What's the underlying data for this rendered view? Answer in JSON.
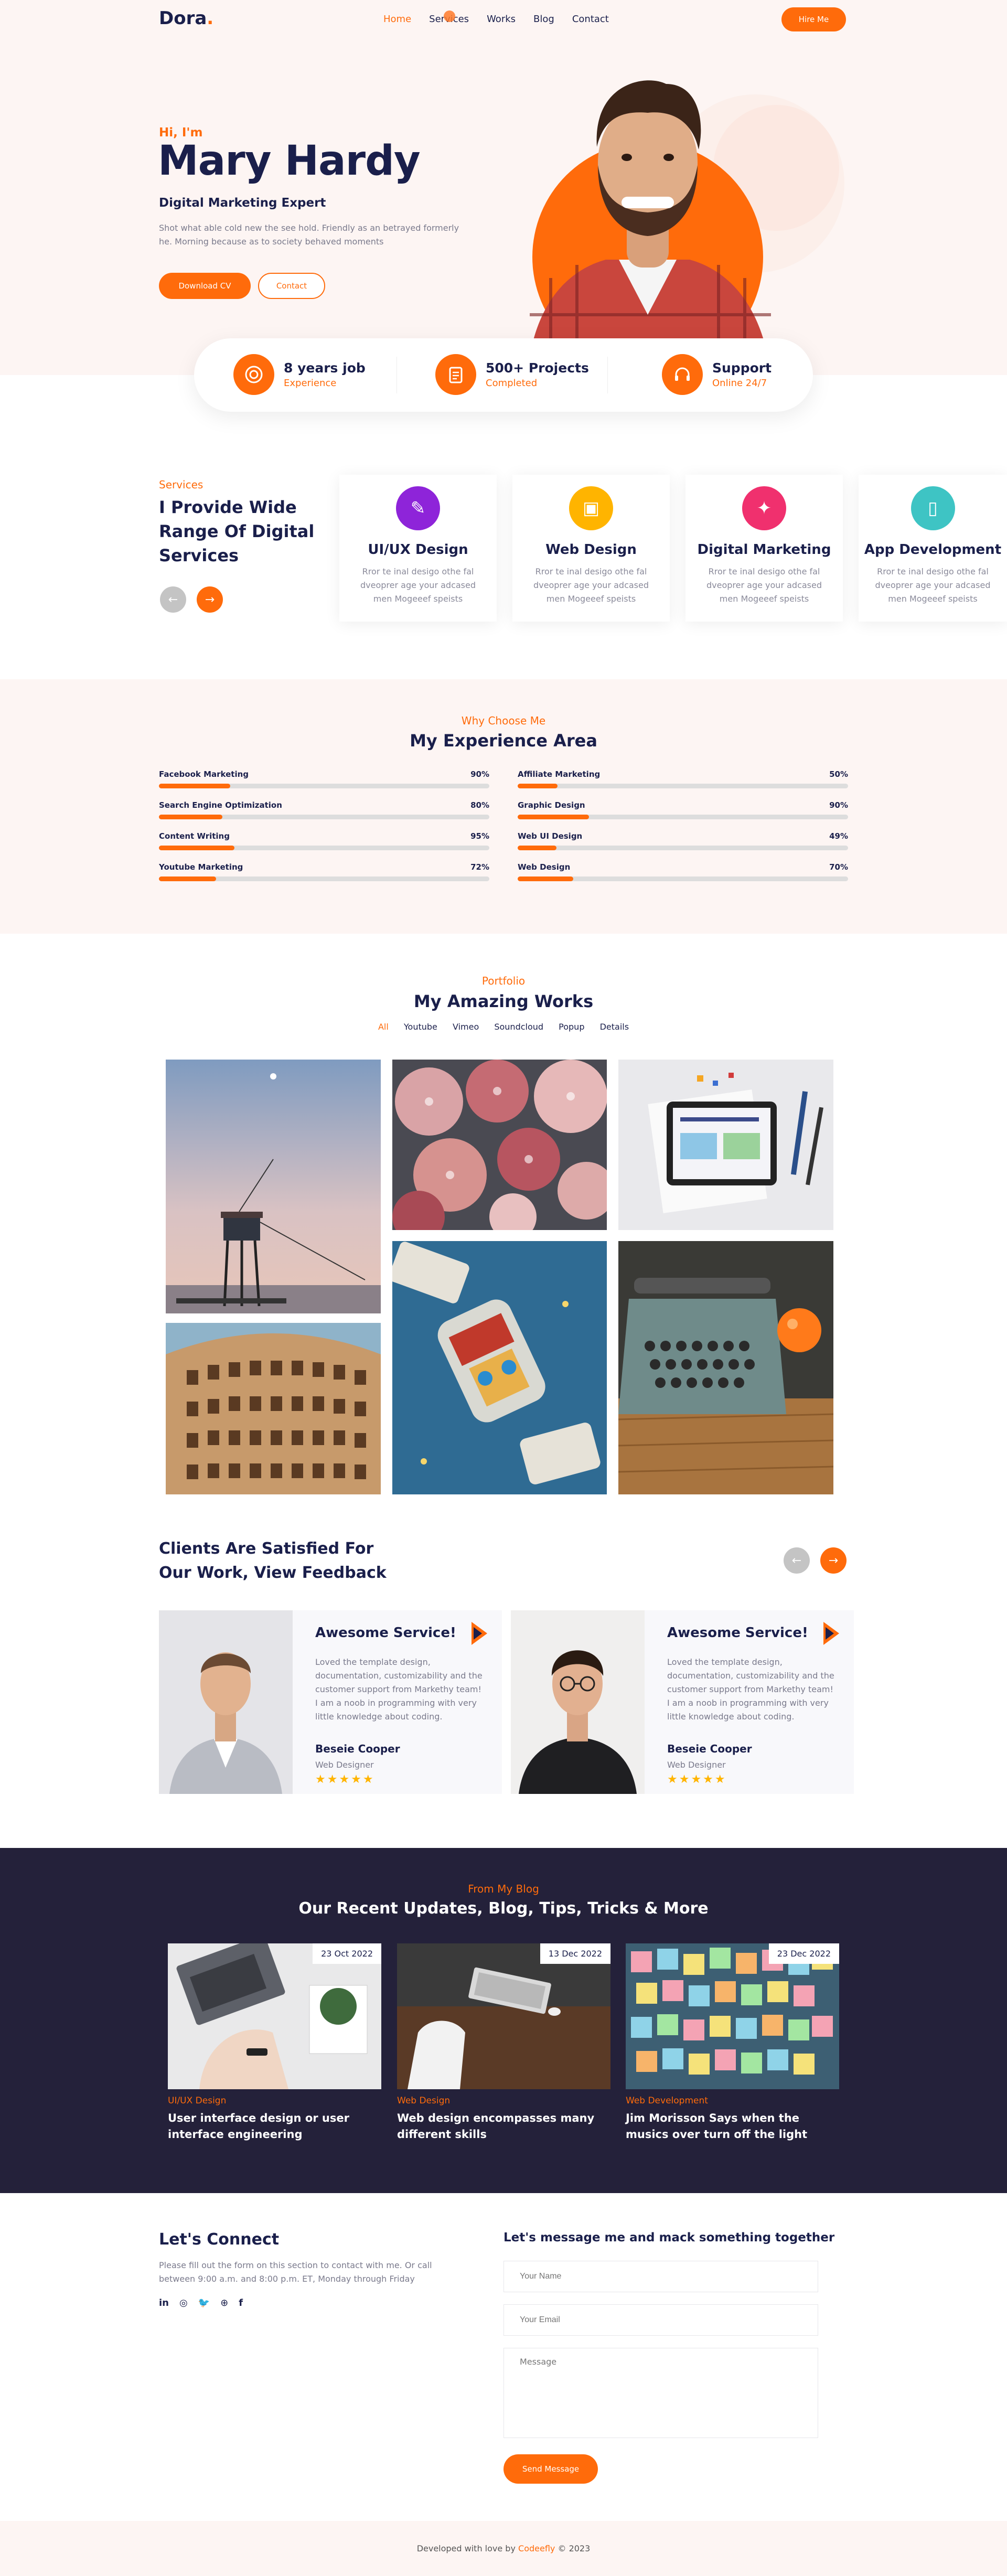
{
  "brand": {
    "name": "Dora",
    "dot": "."
  },
  "nav": {
    "items": [
      {
        "label": "Home",
        "active": true
      },
      {
        "label": "Services",
        "active": false
      },
      {
        "label": "Works",
        "active": false
      },
      {
        "label": "Blog",
        "active": false
      },
      {
        "label": "Contact",
        "active": false
      }
    ],
    "hire_label": "Hire Me"
  },
  "hero": {
    "greeting": "Hi, I'm",
    "name": "Mary Hardy",
    "role": "Digital Marketing Expert",
    "description": "Shot what able cold new the see hold. Friendly as an betrayed formerly he. Morning because as to society behaved moments",
    "download_label": "Download CV",
    "contact_label": "Contact"
  },
  "stats": [
    {
      "title": "8 years job",
      "sub": "Experience",
      "icon": "award-icon"
    },
    {
      "title": "500+ Projects",
      "sub": "Completed",
      "icon": "clipboard-icon"
    },
    {
      "title": "Support",
      "sub": "Online 24/7",
      "icon": "headset-icon"
    }
  ],
  "services": {
    "tag": "Services",
    "heading_lines": [
      "I Provide Wide",
      "Range Of Digital",
      "Services"
    ],
    "prev_label": "←",
    "next_label": "→",
    "cards": [
      {
        "title": "UI/UX Design",
        "desc": "Rror te inal desigo othe fal dveoprer age your adcased men Mogeeef speists",
        "color": "#8e24d9",
        "icon": "pen-tool-icon",
        "glyph": "✎"
      },
      {
        "title": "Web Design",
        "desc": "Rror te inal desigo othe fal dveoprer age your adcased men Mogeeef speists",
        "color": "#ffb400",
        "icon": "browser-icon",
        "glyph": "▣"
      },
      {
        "title": "Digital Marketing",
        "desc": "Rror te inal desigo othe fal dveoprer age your adcased men Mogeeef speists",
        "color": "#f0306e",
        "icon": "megaphone-icon",
        "glyph": "✦"
      },
      {
        "title": "App Development",
        "desc": "Rror te inal desigo othe fal dveoprer age your adcased men Mogeeef speists",
        "color": "#3ec4c4",
        "icon": "mobile-icon",
        "glyph": "▯"
      }
    ]
  },
  "skills": {
    "tag": "Why Choose Me",
    "heading": "My Experience Area",
    "items": [
      {
        "label": "Facebook Marketing",
        "value": 90,
        "pct": "90%"
      },
      {
        "label": "Affiliate Marketing",
        "value": 50,
        "pct": "50%"
      },
      {
        "label": "Search Engine Optimization",
        "value": 80,
        "pct": "80%"
      },
      {
        "label": "Graphic Design",
        "value": 90,
        "pct": "90%"
      },
      {
        "label": "Content Writing",
        "value": 95,
        "pct": "95%"
      },
      {
        "label": "Web UI Design",
        "value": 49,
        "pct": "49%"
      },
      {
        "label": "Youtube Marketing",
        "value": 72,
        "pct": "72%"
      },
      {
        "label": "Web Design",
        "value": 70,
        "pct": "70%"
      }
    ]
  },
  "portfolio": {
    "tag": "Portfolio",
    "heading": "My Amazing Works",
    "tabs": [
      "All",
      "Youtube",
      "Vimeo",
      "Soundcloud",
      "Popup",
      "Details"
    ]
  },
  "testimonials": {
    "heading_lines": [
      "Clients Are Satisfied For",
      "Our Work, View Feedback"
    ],
    "prev_label": "←",
    "next_label": "→",
    "cards": [
      {
        "title": "Awesome Service!",
        "text": "Loved the template design, documentation, customizability and the customer support from Markethy team! I am a noob in programming with very little knowledge about coding.",
        "name": "Beseie Cooper",
        "role": "Web Designer",
        "stars": "★★★★★"
      },
      {
        "title": "Awesome Service!",
        "text": "Loved the template design, documentation, customizability and the customer support from Markethy team! I am a noob in programming with very little knowledge about coding.",
        "name": "Beseie Cooper",
        "role": "Web Designer",
        "stars": "★★★★★"
      }
    ]
  },
  "blog": {
    "tag": "From My Blog",
    "heading": "Our Recent Updates, Blog, Tips, Tricks & More",
    "posts": [
      {
        "date": "23 Oct 2022",
        "category": "UI/UX Design",
        "title": "User interface design or user interface engineering"
      },
      {
        "date": "13 Dec 2022",
        "category": "Web Design",
        "title": "Web design encompasses many different skills"
      },
      {
        "date": "23 Dec 2022",
        "category": "Web Development",
        "title": "Jim Morisson Says when the musics over turn off the light"
      }
    ]
  },
  "contact": {
    "heading": "Let's Connect",
    "description": "Please fill out the form on this section to contact with me. Or call between 9:00 a.m. and 8:00 p.m. ET, Monday through Friday",
    "socials": [
      {
        "icon": "linkedin-icon",
        "glyph": "in"
      },
      {
        "icon": "instagram-icon",
        "glyph": "◎"
      },
      {
        "icon": "twitter-icon",
        "glyph": "🐦"
      },
      {
        "icon": "dribbble-icon",
        "glyph": "⊕"
      },
      {
        "icon": "facebook-icon",
        "glyph": "f"
      }
    ],
    "form_heading": "Let's message me and mack something together",
    "name_placeholder": "Your Name",
    "email_placeholder": "Your Email",
    "message_placeholder": "Message",
    "send_label": "Send Message"
  },
  "footer": {
    "prefix": "Developed with love by",
    "brand": "Codeefly",
    "suffix": "© 2023"
  },
  "colors": {
    "accent": "#ff6b0b",
    "navy": "#1a1f4b",
    "hero_bg": "#fdf5f3",
    "blog_bg": "#24213a"
  }
}
